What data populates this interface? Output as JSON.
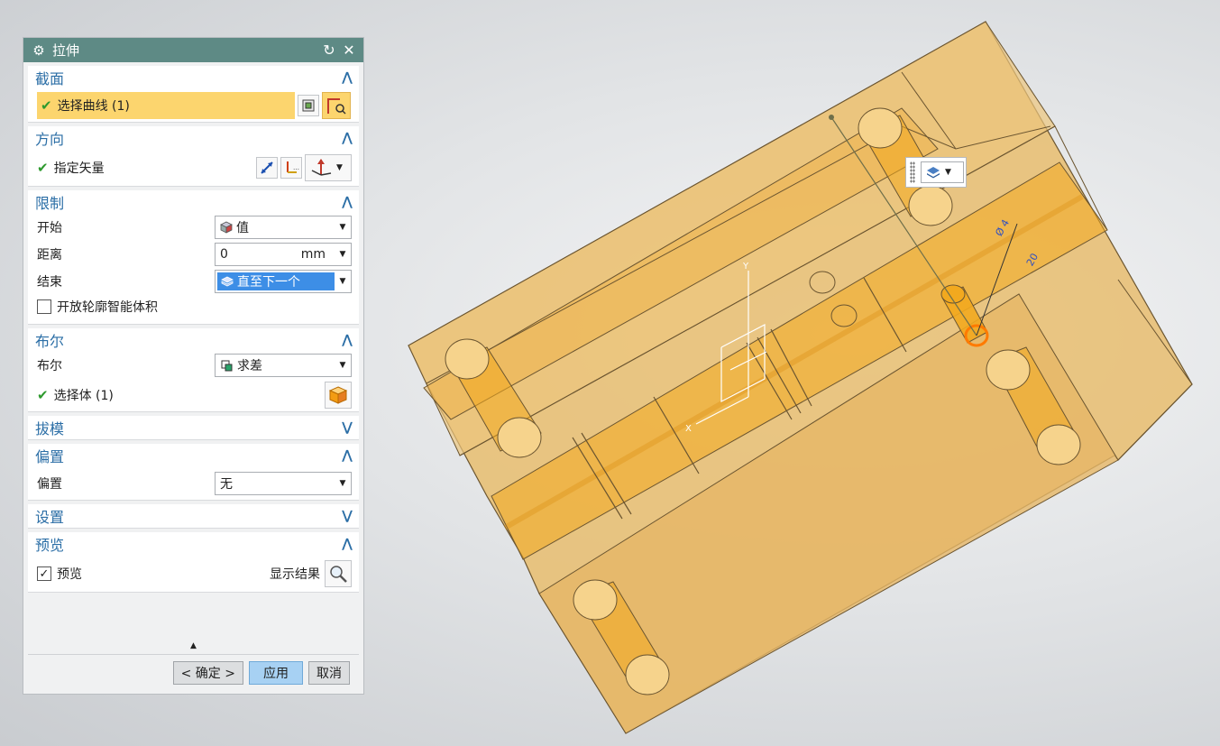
{
  "dialog": {
    "title": "拉伸",
    "title_icon": "gear-icon",
    "reset_icon": "reset-icon",
    "close_icon": "close-icon"
  },
  "sections": {
    "section": {
      "title": "截面",
      "select_curve": "选择曲线 (1)"
    },
    "direction": {
      "title": "方向",
      "specify_vector": "指定矢量"
    },
    "limits": {
      "title": "限制",
      "start_label": "开始",
      "start_value": "值",
      "distance_label": "距离",
      "distance_value": "0",
      "distance_unit": "mm",
      "end_label": "结束",
      "end_value": "直至下一个",
      "open_profile": "开放轮廓智能体积"
    },
    "boolean": {
      "title": "布尔",
      "boolean_label": "布尔",
      "boolean_value": "求差",
      "select_body": "选择体 (1)"
    },
    "draft": {
      "title": "拔模"
    },
    "offset": {
      "title": "偏置",
      "offset_label": "偏置",
      "offset_value": "无"
    },
    "settings": {
      "title": "设置"
    },
    "preview": {
      "title": "预览",
      "preview_label": "预览",
      "show_result": "显示结果"
    }
  },
  "buttons": {
    "ok": "< 确定 >",
    "apply": "应用",
    "cancel": "取消"
  },
  "colors": {
    "title_bar": "#5e8a85",
    "section_title": "#2b6ea6",
    "selection_highlight": "#fcd56e",
    "apply_button": "#a7d1f3",
    "model_body": "#e3b563",
    "model_cylinder": "#f2a91f"
  }
}
